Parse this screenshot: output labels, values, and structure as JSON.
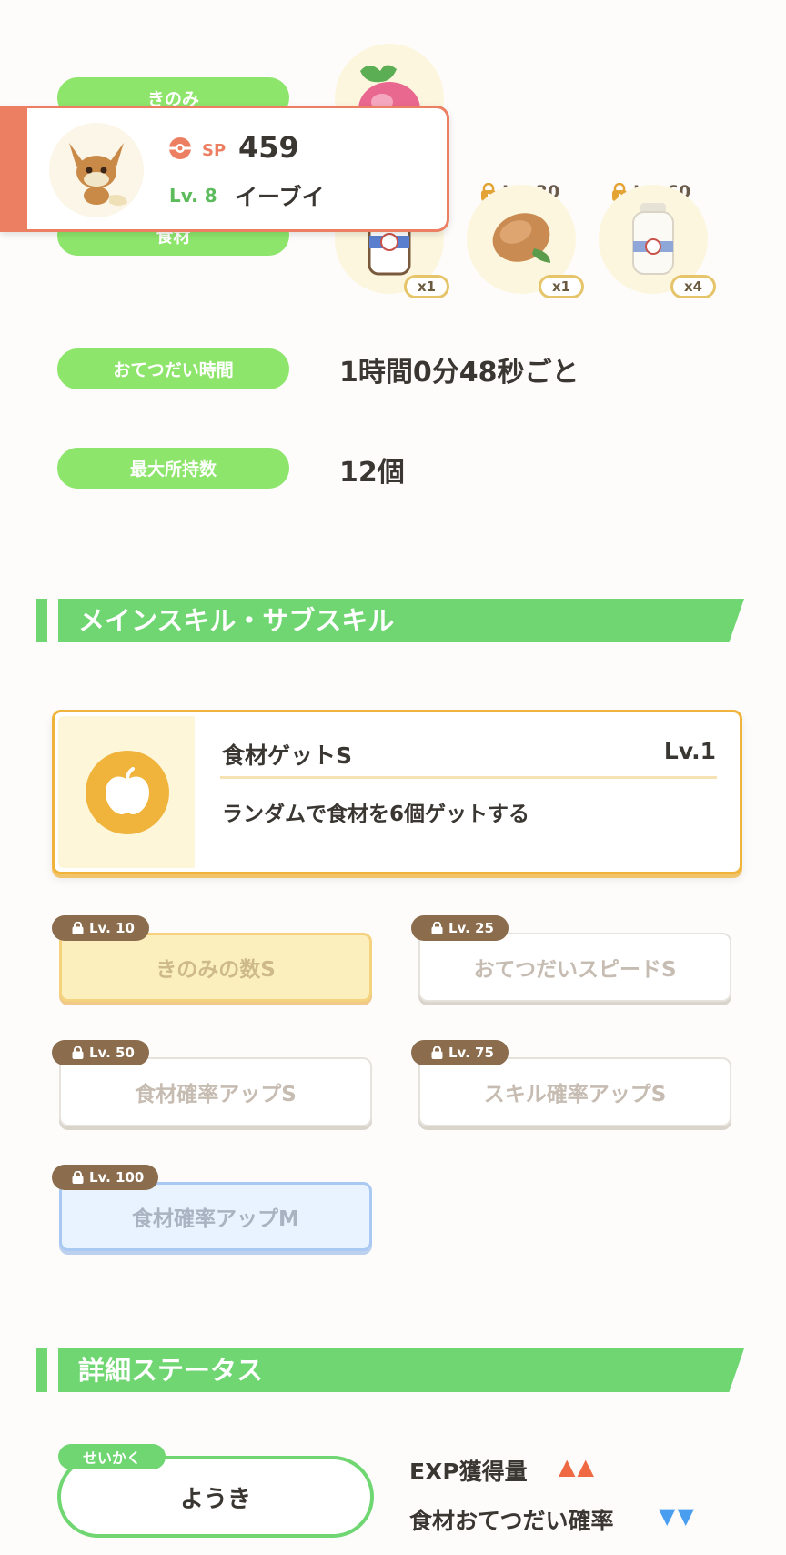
{
  "berry_label": "きのみ",
  "ingredients_label": "食材",
  "ingredients": [
    {
      "unlock": "",
      "qty": "x1",
      "item": "milk-bottle-icon"
    },
    {
      "unlock": "Lv. 30",
      "qty": "x1",
      "item": "cacao-icon"
    },
    {
      "unlock": "Lv. 60",
      "qty": "x4",
      "item": "milk-bottle-icon"
    }
  ],
  "help_time_label": "おてつだい時間",
  "help_time_value": "1時間0分48秒ごと",
  "max_carry_label": "最大所持数",
  "max_carry_value": "12個",
  "popup": {
    "sp_label": "SP",
    "sp_value": "459",
    "level": "Lv. 8",
    "name": "イーブイ"
  },
  "skills_section_title": "メインスキル・サブスキル",
  "main_skill": {
    "name": "食材ゲットS",
    "level": "Lv.1",
    "description": "ランダムで食材を6個ゲットする"
  },
  "sub_skills": [
    {
      "unlock": "Lv. 10",
      "name": "きのみの数S",
      "tier": "gold"
    },
    {
      "unlock": "Lv. 25",
      "name": "おてつだいスピードS",
      "tier": "white"
    },
    {
      "unlock": "Lv. 50",
      "name": "食材確率アップS",
      "tier": "white"
    },
    {
      "unlock": "Lv. 75",
      "name": "スキル確率アップS",
      "tier": "white"
    },
    {
      "unlock": "Lv. 100",
      "name": "食材確率アップM",
      "tier": "blue"
    }
  ],
  "details_section_title": "詳細ステータス",
  "nature": {
    "tag": "せいかく",
    "value": "ようき",
    "up_label": "EXP獲得量",
    "up_marks": "▲▲",
    "down_label": "食材おてつだい確率",
    "down_marks": "▼▼"
  },
  "colors": {
    "accent_green": "#6fd672",
    "label_green": "#8de56c",
    "popup_accent": "#ec7f62",
    "gold": "#f0b43c",
    "up_red": "#ef6a43",
    "down_blue": "#4a9ef0"
  }
}
